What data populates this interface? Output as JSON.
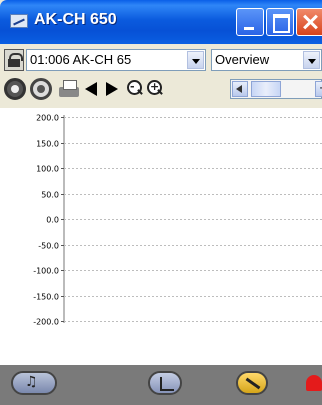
{
  "window": {
    "title": "AK-CH 650"
  },
  "toolbar": {
    "device_selected": "01:006 AK-CH 65",
    "view_selected": "Overview",
    "zoom_out_label": "-",
    "zoom_in_label": "+",
    "scroll_right_label": "+"
  },
  "chart_data": {
    "type": "line",
    "title": "",
    "xlabel": "",
    "ylabel": "",
    "ylim": [
      -200,
      200
    ],
    "y_ticks": [
      "200.0",
      "150.0",
      "100.0",
      "50.0",
      "0.0",
      "-50.0",
      "-100.0",
      "-150.0",
      "-200.0"
    ],
    "series": [],
    "grid": true
  },
  "bottombar": {
    "icons": [
      "tools-icon",
      "graph-icon",
      "alarm-icon",
      "bell-icon"
    ]
  },
  "colors": {
    "titlebar": "#0a5fe2",
    "window_bg": "#ece9d8",
    "bottombar": "#7a7a7a",
    "grid": "#bdbdbd"
  }
}
